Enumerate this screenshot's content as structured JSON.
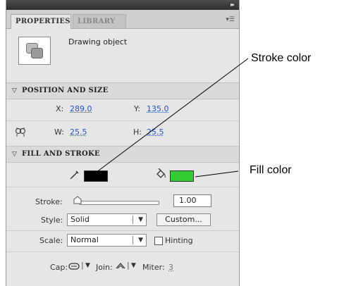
{
  "tabs": {
    "properties": "PROPERTIES",
    "library": "LIBRARY"
  },
  "object": {
    "type_label": "Drawing object"
  },
  "position_size": {
    "heading": "POSITION AND SIZE",
    "x_label": "X:",
    "x_value": "289.0",
    "y_label": "Y:",
    "y_value": "135.0",
    "w_label": "W:",
    "w_value": "25.5",
    "h_label": "H:",
    "h_value": "25.5"
  },
  "fill_stroke": {
    "heading": "FILL AND STROKE",
    "stroke_color": "#000000",
    "fill_color": "#33cc33",
    "stroke_label": "Stroke:",
    "stroke_value": "1.00",
    "style_label": "Style:",
    "style_value": "Solid",
    "custom_button": "Custom...",
    "scale_label": "Scale:",
    "scale_value": "Normal",
    "hinting_label": "Hinting",
    "cap_label": "Cap:",
    "join_label": "Join:",
    "miter_label": "Miter:",
    "miter_value": "3"
  },
  "annotations": {
    "stroke_color": "Stroke color",
    "fill_color": "Fill color"
  }
}
